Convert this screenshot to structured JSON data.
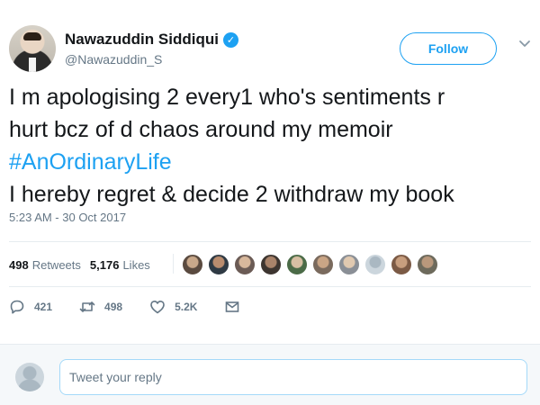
{
  "author": {
    "name": "Nawazuddin Siddiqui",
    "handle": "@Nawazuddin_S",
    "verified_icon": "verified-badge-icon"
  },
  "follow_button": {
    "label": "Follow"
  },
  "menu": {
    "icon": "chevron-down-icon"
  },
  "tweet": {
    "lines": [
      "I m apologising 2 every1 who's sentiments r",
      "hurt bcz of d chaos around my memoir",
      "#AnOrdinaryLife",
      "I hereby regret & decide 2 withdraw my book"
    ],
    "timestamp": "5:23 AM - 30 Oct 2017"
  },
  "stats": {
    "retweets_count": "498",
    "retweets_label": "Retweets",
    "likes_count": "5,176",
    "likes_label": "Likes"
  },
  "likers": [
    {
      "bg": "#5a4a3f",
      "face": "#c9a88a"
    },
    {
      "bg": "#2f3a44",
      "face": "#b98c6e"
    },
    {
      "bg": "#6b5b55",
      "face": "#d8b89c"
    },
    {
      "bg": "#3d3530",
      "face": "#a9836a"
    },
    {
      "bg": "#4b6b47",
      "face": "#d7bfa3"
    },
    {
      "bg": "#7a6a5d",
      "face": "#caa585"
    },
    {
      "bg": "#8a8f96",
      "face": "#e0c9b0"
    },
    {
      "bg": "#ccd6dd",
      "face": "#aab8c2"
    },
    {
      "bg": "#7b5a45",
      "face": "#c79e7e"
    },
    {
      "bg": "#6d6a5c",
      "face": "#b9987c"
    }
  ],
  "actions": {
    "reply_count": "421",
    "retweet_count": "498",
    "like_count": "5.2K"
  },
  "reply": {
    "placeholder": "Tweet your reply"
  },
  "colors": {
    "accent": "#1da1f2",
    "secondary_text": "#657786",
    "border": "#e6ecf0"
  }
}
